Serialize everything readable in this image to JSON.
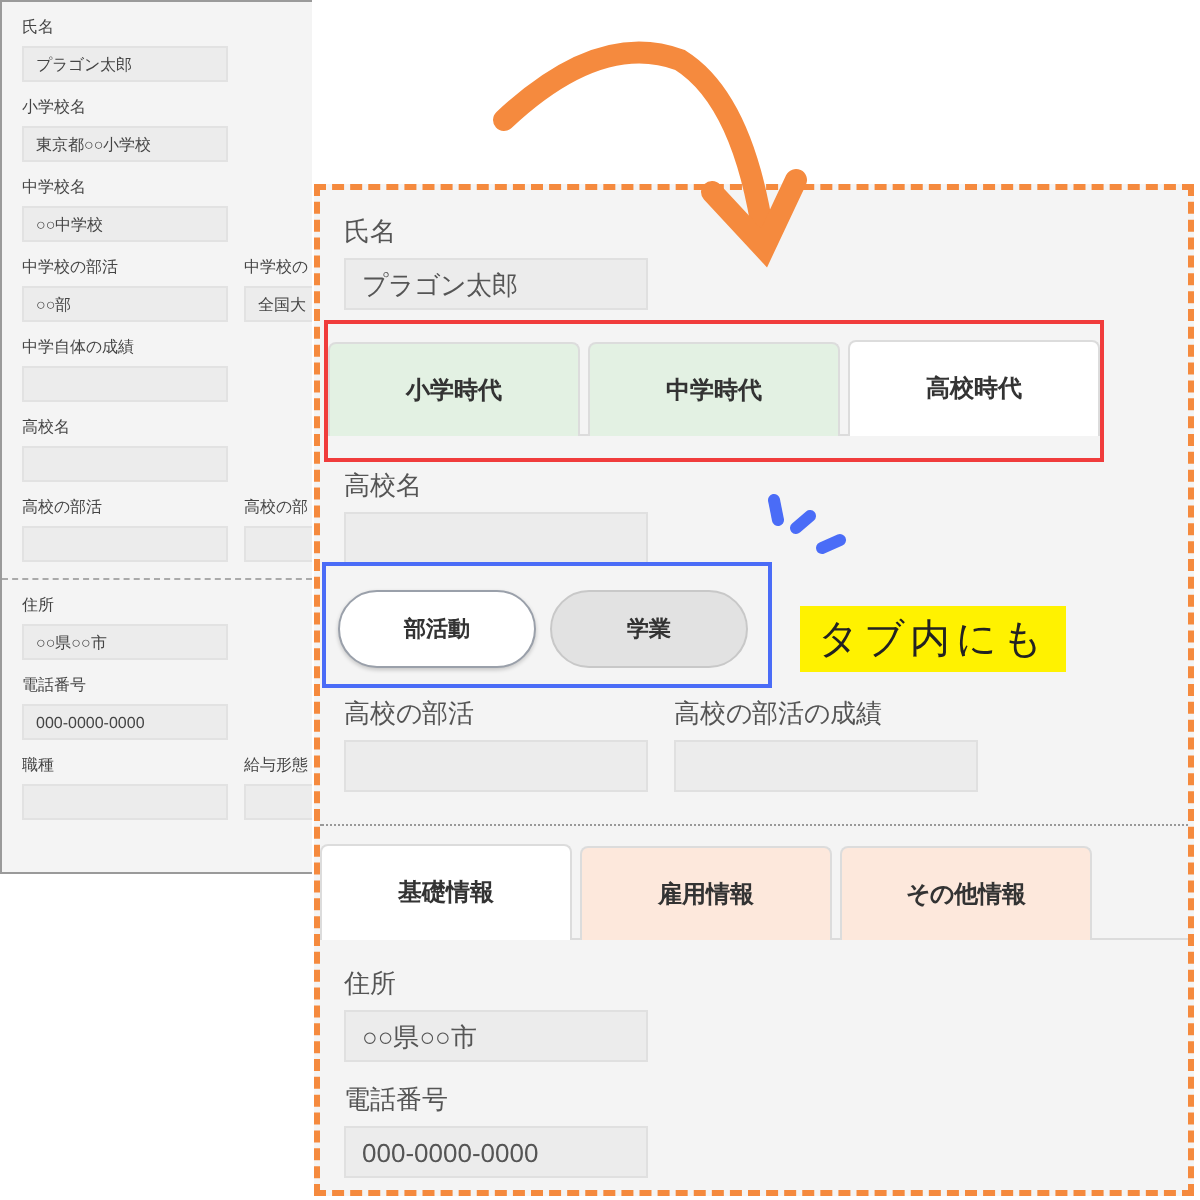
{
  "back_form": {
    "sections": [
      {
        "rows": [
          {
            "fields": [
              {
                "label": "氏名",
                "value": "プラゴン太郎"
              }
            ]
          },
          {
            "fields": [
              {
                "label": "小学校名",
                "value": "東京都○○小学校"
              }
            ]
          },
          {
            "fields": [
              {
                "label": "中学校名",
                "value": "○○中学校"
              }
            ]
          },
          {
            "fields": [
              {
                "label": "中学校の部活",
                "value": "○○部"
              },
              {
                "label": "中学校の",
                "value": "全国大"
              }
            ]
          },
          {
            "fields": [
              {
                "label": "中学自体の成績"
              }
            ]
          },
          {
            "fields": [
              {
                "label": "高校名"
              }
            ]
          },
          {
            "fields": [
              {
                "label": "高校の部活"
              },
              {
                "label": "高校の部"
              }
            ]
          }
        ]
      },
      {
        "rows": [
          {
            "fields": [
              {
                "label": "住所",
                "value": "○○県○○市"
              }
            ]
          },
          {
            "fields": [
              {
                "label": "電話番号",
                "value": "000-0000-0000"
              }
            ]
          },
          {
            "fields": [
              {
                "label": "職種"
              },
              {
                "label": "給与形態"
              }
            ]
          }
        ]
      }
    ]
  },
  "front_form": {
    "name_field": {
      "label": "氏名",
      "value": "プラゴン太郎"
    },
    "period_tabs": [
      {
        "label": "小学時代",
        "selected": false
      },
      {
        "label": "中学時代",
        "selected": false
      },
      {
        "label": "高校時代",
        "selected": true
      }
    ],
    "school_field": {
      "label": "高校名"
    },
    "club_tabs": [
      {
        "label": "部活動",
        "selected": true
      },
      {
        "label": "学業",
        "selected": false
      }
    ],
    "club_fields": [
      {
        "label": "高校の部活"
      },
      {
        "label": "高校の部活の成績"
      }
    ],
    "info_tabs": [
      {
        "label": "基礎情報",
        "selected": true
      },
      {
        "label": "雇用情報",
        "selected": false
      },
      {
        "label": "その他情報",
        "selected": false
      }
    ],
    "info_fields": [
      {
        "label": "住所",
        "value": "○○県○○市"
      },
      {
        "label": "電話番号",
        "value": "000-0000-0000"
      }
    ]
  },
  "note": "タブ内にも"
}
